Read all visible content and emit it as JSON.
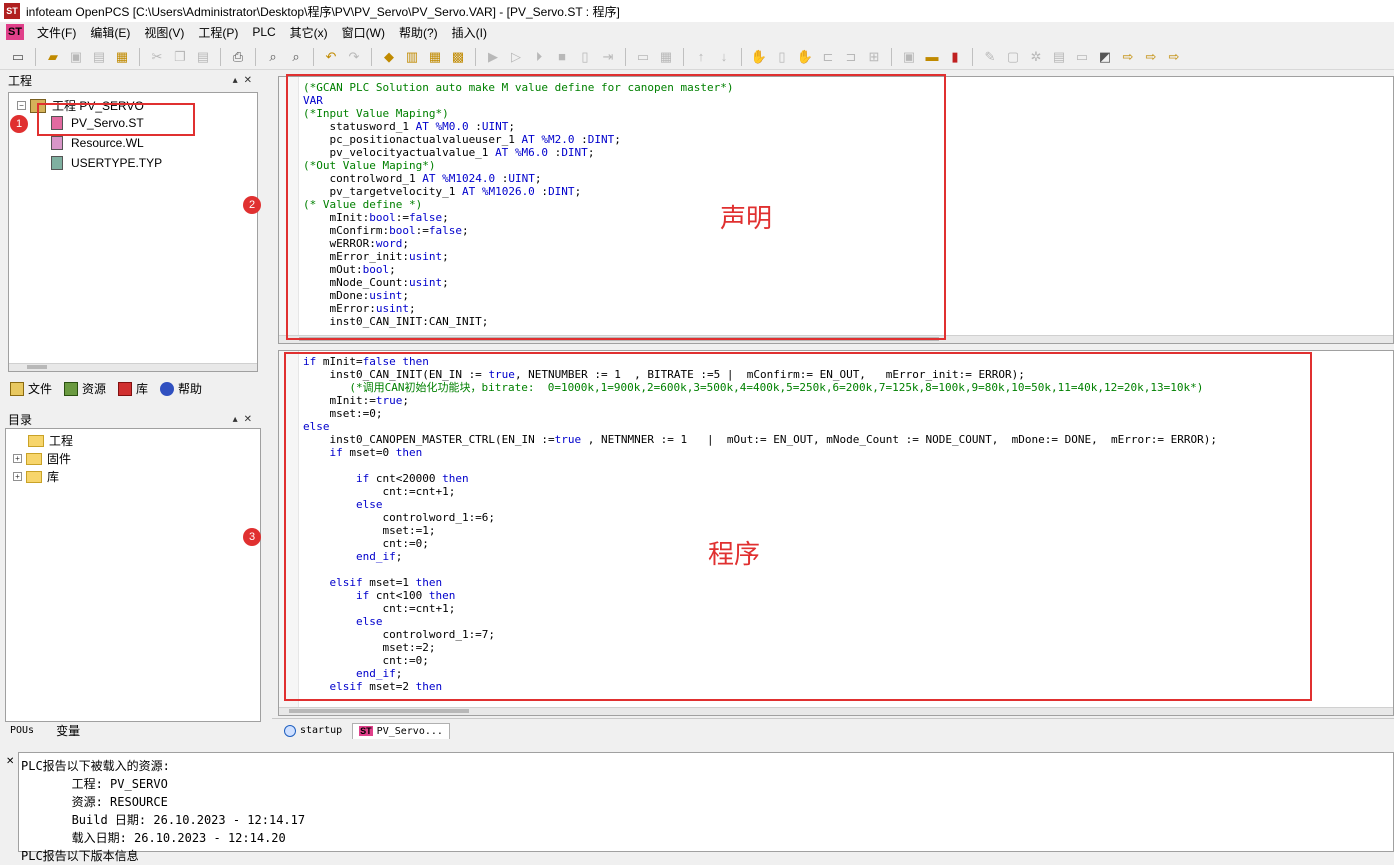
{
  "window": {
    "app_icon": "ST",
    "title": "infoteam OpenPCS [C:\\Users\\Administrator\\Desktop\\程序\\PV\\PV_Servo\\PV_Servo.VAR]  - [PV_Servo.ST : 程序]"
  },
  "menu": {
    "logo": "ST",
    "items": [
      "文件(F)",
      "编辑(E)",
      "视图(V)",
      "工程(P)",
      "PLC",
      "其它(x)",
      "窗口(W)",
      "帮助(?)",
      "插入(I)"
    ]
  },
  "project_panel": {
    "title": "工程",
    "tree": {
      "root": "工程 PV_SERVO",
      "files": [
        "PV_Servo.ST",
        "Resource.WL",
        "USERTYPE.TYP"
      ]
    },
    "tabs": [
      "文件",
      "资源",
      "库",
      "帮助"
    ]
  },
  "catalog_panel": {
    "title": "目录",
    "items": [
      "工程",
      "固件",
      "库"
    ],
    "tabs": [
      "POUs",
      "变量"
    ]
  },
  "declaration_code": [
    "(*GCAN PLC Solution auto make M value define for canopen master*)",
    "VAR",
    "(*Input Value Maping*)",
    "    statusword_1 AT %M0.0 :UINT;",
    "    pc_positionactualvalueuser_1 AT %M2.0 :DINT;",
    "    pv_velocityactualvalue_1 AT %M6.0 :DINT;",
    "(*Out Value Maping*)",
    "    controlword_1 AT %M1024.0 :UINT;",
    "    pv_targetvelocity_1 AT %M1026.0 :DINT;",
    "(* Value define *)",
    "    mInit:bool:=false;",
    "    mConfirm:bool:=false;",
    "    wERROR:word;",
    "    mError_init:usint;",
    "    mOut:bool;",
    "    mNode_Count:usint;",
    "    mDone:usint;",
    "    mError:usint;",
    "    inst0_CAN_INIT:CAN_INIT;"
  ],
  "program_code": [
    "if mInit=false then",
    "    inst0_CAN_INIT(EN_IN := true, NETNUMBER := 1  , BITRATE :=5 |  mConfirm:= EN_OUT,   mError_init:= ERROR);",
    "       (*调用CAN初始化功能块，bitrate:  0=1000k,1=900k,2=600k,3=500k,4=400k,5=250k,6=200k,7=125k,8=100k,9=80k,10=50k,11=40k,12=20k,13=10k*)",
    "    mInit:=true;",
    "    mset:=0;",
    "else",
    "    inst0_CANOPEN_MASTER_CTRL(EN_IN :=true , NETNMNER := 1   |  mOut:= EN_OUT, mNode_Count := NODE_COUNT,  mDone:= DONE,  mError:= ERROR);",
    "    if mset=0 then",
    "",
    "        if cnt<20000 then",
    "            cnt:=cnt+1;",
    "        else",
    "            controlword_1:=6;",
    "            mset:=1;",
    "            cnt:=0;",
    "        end_if;",
    "",
    "    elsif mset=1 then",
    "        if cnt<100 then",
    "            cnt:=cnt+1;",
    "        else",
    "            controlword_1:=7;",
    "            mset:=2;",
    "            cnt:=0;",
    "        end_if;",
    "    elsif mset=2 then"
  ],
  "annotations": {
    "badge_1": "1",
    "badge_2": "2",
    "badge_3": "3",
    "declaration_label": "声明",
    "program_label": "程序"
  },
  "editor_tabs": [
    {
      "label": "startup"
    },
    {
      "label": "PV_Servo...",
      "badge": "ST"
    }
  ],
  "output_lines": [
    "PLC报告以下被载入的资源:",
    "       工程: PV_SERVO",
    "       资源: RESOURCE",
    "       Build 日期: 26.10.2023 - 12:14.17",
    "       载入日期: 26.10.2023 - 12:14.20",
    "PLC报告以下版本信息"
  ],
  "colors": {
    "annotation": "#e03030",
    "keyword": "#0000cc",
    "comment": "#008000"
  }
}
